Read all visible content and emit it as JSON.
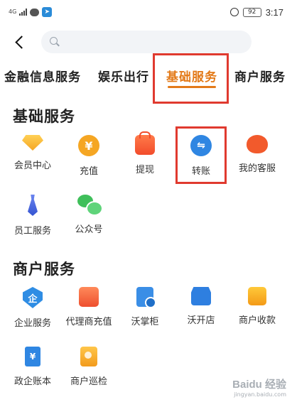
{
  "status_bar": {
    "signal": "4G",
    "battery": "92",
    "time": "3:17"
  },
  "search": {
    "placeholder": ""
  },
  "tabs": [
    {
      "label": "金融信息服务"
    },
    {
      "label": "娱乐出行"
    },
    {
      "label": "基础服务",
      "active": true
    },
    {
      "label": "商户服务"
    }
  ],
  "sections": {
    "basic": {
      "title": "基础服务",
      "items": [
        {
          "label": "会员中心",
          "icon": "diamond-icon"
        },
        {
          "label": "充值",
          "icon": "yuan-coin-icon"
        },
        {
          "label": "提现",
          "icon": "bag-icon"
        },
        {
          "label": "转账",
          "icon": "transfer-icon"
        },
        {
          "label": "我的客服",
          "icon": "headset-icon"
        },
        {
          "label": "员工服务",
          "icon": "tie-icon"
        },
        {
          "label": "公众号",
          "icon": "wechat-icon"
        }
      ]
    },
    "merchant": {
      "title": "商户服务",
      "items": [
        {
          "label": "企业服务",
          "icon": "enterprise-shield-icon"
        },
        {
          "label": "代理商充值",
          "icon": "shop-bag-icon"
        },
        {
          "label": "沃掌柜",
          "icon": "document-check-icon"
        },
        {
          "label": "沃开店",
          "icon": "storefront-icon"
        },
        {
          "label": "商户收款",
          "icon": "grid-icon"
        },
        {
          "label": "政企账本",
          "icon": "ledger-book-icon"
        },
        {
          "label": "商户巡检",
          "icon": "badge-card-icon"
        }
      ]
    }
  },
  "watermark": {
    "logo": "Baidu 经验",
    "url": "jingyan.baidu.com"
  },
  "colors": {
    "accent": "#e37a19",
    "highlight": "#e03a2f",
    "transfer": "#2f86e2"
  }
}
